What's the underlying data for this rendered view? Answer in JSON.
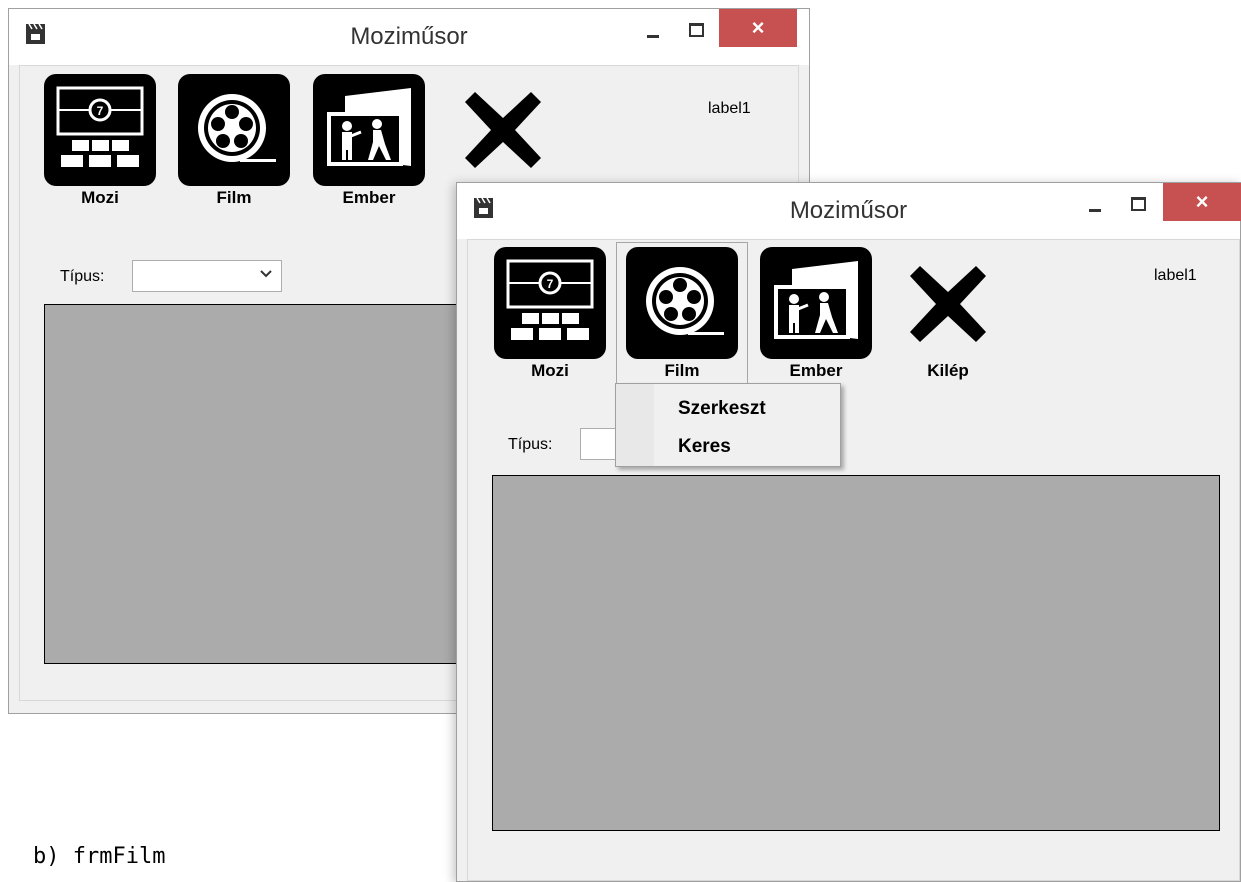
{
  "window": {
    "title": "Moziműsor",
    "close_glyph": "×",
    "minimize_icon": "minimize-icon",
    "maximize_icon": "maximize-icon"
  },
  "toolbar": {
    "mozi_label": "Mozi",
    "film_label": "Film",
    "ember_label": "Ember",
    "kilep_label": "Kilép"
  },
  "label1": "label1",
  "tipus_label": "Típus:",
  "combo_value": "",
  "film_menu": {
    "items": [
      "Szerkeszt",
      "Keres"
    ]
  },
  "caption": "b)  frmFilm",
  "colors": {
    "close_button": "#c75050",
    "panel": "#ababab",
    "client": "#f0f0f0"
  },
  "icons": [
    "clapperboard-icon",
    "cinema-screen-icon",
    "film-reel-icon",
    "people-screen-icon",
    "exit-x-icon",
    "chevron-down-icon"
  ]
}
